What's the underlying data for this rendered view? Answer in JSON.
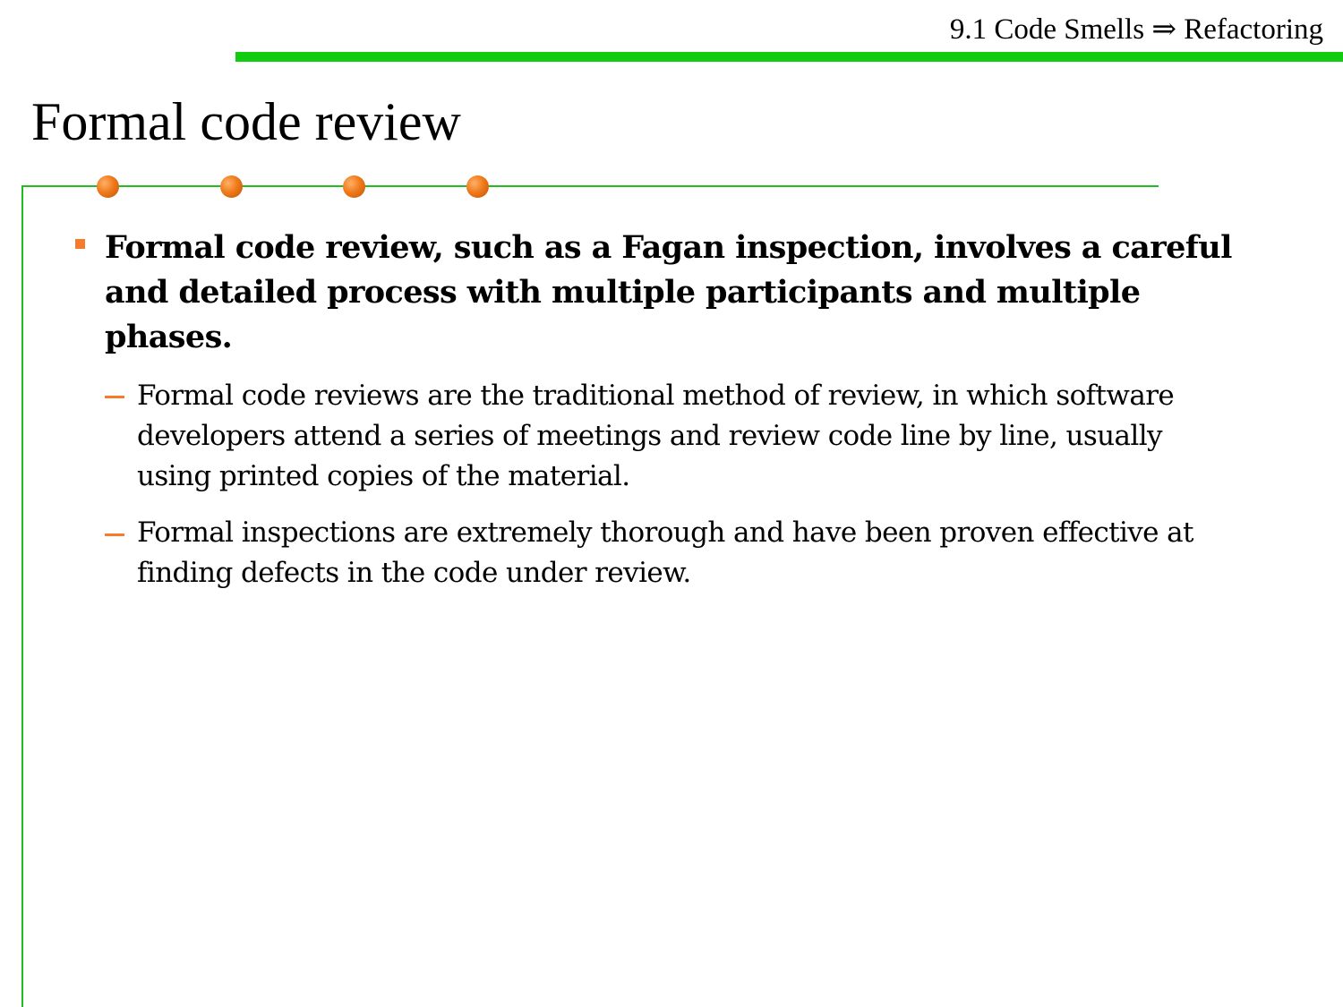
{
  "header": {
    "section_title": "9.1 Code Smells ⇒ Refactoring",
    "accent_color": "#11cc11"
  },
  "slide": {
    "title": "Formal code review",
    "bullet_color": "#f47c2c",
    "bullets": [
      {
        "text": "Formal code review, such as a Fagan inspection, involves a careful and detailed process with multiple participants and multiple phases.",
        "sub_bullets": [
          "Formal code reviews are the traditional method of review, in which software developers attend a series of meetings and review code line by line, usually using printed copies of the material.",
          "Formal inspections are extremely thorough and have been proven effective at finding defects in the code under review."
        ]
      }
    ]
  }
}
